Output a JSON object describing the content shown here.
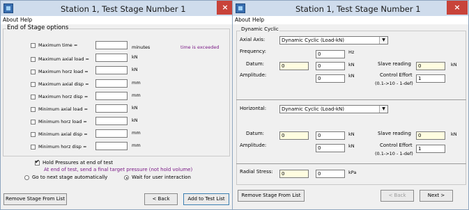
{
  "left_window": {
    "title": "Station 1, Test Stage Number 1",
    "menu": [
      "About",
      "Help"
    ],
    "group_title": "End of Stage options",
    "options": [
      {
        "label": "Maximum time =",
        "unit": "minutes",
        "checked": false
      },
      {
        "label": "Maximum axial load =",
        "unit": "kN",
        "checked": false
      },
      {
        "label": "Maximum horz load =",
        "unit": "kN",
        "checked": false
      },
      {
        "label": "Maximum axial disp =",
        "unit": "mm",
        "checked": false
      },
      {
        "label": "Maximum horz disp =",
        "unit": "mm",
        "checked": false
      },
      {
        "label": "Minimum axial load =",
        "unit": "kN",
        "checked": false
      },
      {
        "label": "Minimum horz load =",
        "unit": "kN",
        "checked": false
      },
      {
        "label": "Minimum axial disp =",
        "unit": "mm",
        "checked": false
      },
      {
        "label": "Minimum horz disp =",
        "unit": "mm",
        "checked": false
      }
    ],
    "note": "time is exceeded",
    "hold_label": "Hold Pressures at end of test",
    "hold_note": "At end of test, send a final target pressure (not hold volume)",
    "radio_next": "Go to next stage automatically",
    "radio_wait": "Wait for user interaction",
    "btn_remove": "Remove Stage From List",
    "btn_back": "< Back",
    "btn_add": "Add to Test List"
  },
  "right_window": {
    "title": "Station 1, Test Stage Number 1",
    "menu": [
      "About",
      "Help"
    ],
    "group_title": "Dynamic Cyclic",
    "axial": {
      "label": "Axial Axis:",
      "selected": "Dynamic Cyclic (Load-kN)",
      "freq_label": "Frequency:",
      "freq_value": "0",
      "freq_unit": "Hz",
      "datum_label": "Datum:",
      "datum_yellow": "0",
      "datum_value": "0",
      "datum_unit": "kN",
      "slave_label": "Slave reading",
      "slave_value": "0",
      "slave_unit": "kN",
      "amp_label": "Amplitude:",
      "amp_value": "0",
      "amp_unit": "kN",
      "ce_label": "Control Effort",
      "ce_value": "1",
      "ce_hint": "(0.1->10 - 1-def)"
    },
    "horizontal": {
      "label": "Horizontal:",
      "selected": "Dynamic Cyclic (Load-kN)",
      "datum_label": "Datum:",
      "datum_yellow": "0",
      "datum_value": "0",
      "datum_unit": "kN",
      "slave_label": "Slave reading",
      "slave_value": "0",
      "slave_unit": "kN",
      "amp_label": "Amplitude:",
      "amp_value": "0",
      "amp_unit": "kN",
      "ce_label": "Control Effort",
      "ce_value": "1",
      "ce_hint": "(0.1->10 - 1-def)"
    },
    "radial": {
      "label": "Radial Stress:",
      "yellow": "0",
      "value": "0",
      "unit": "kPa"
    },
    "btn_remove": "Remove Stage From List",
    "btn_back": "< Back",
    "btn_next": "Next >"
  },
  "colors": {
    "accent_purple": "#7a1a86",
    "close_red": "#c8433a",
    "field_yellow": "#fffde0"
  },
  "icons": [
    "app-icon",
    "close-icon",
    "checkbox",
    "radio",
    "dropdown-arrow-icon"
  ]
}
